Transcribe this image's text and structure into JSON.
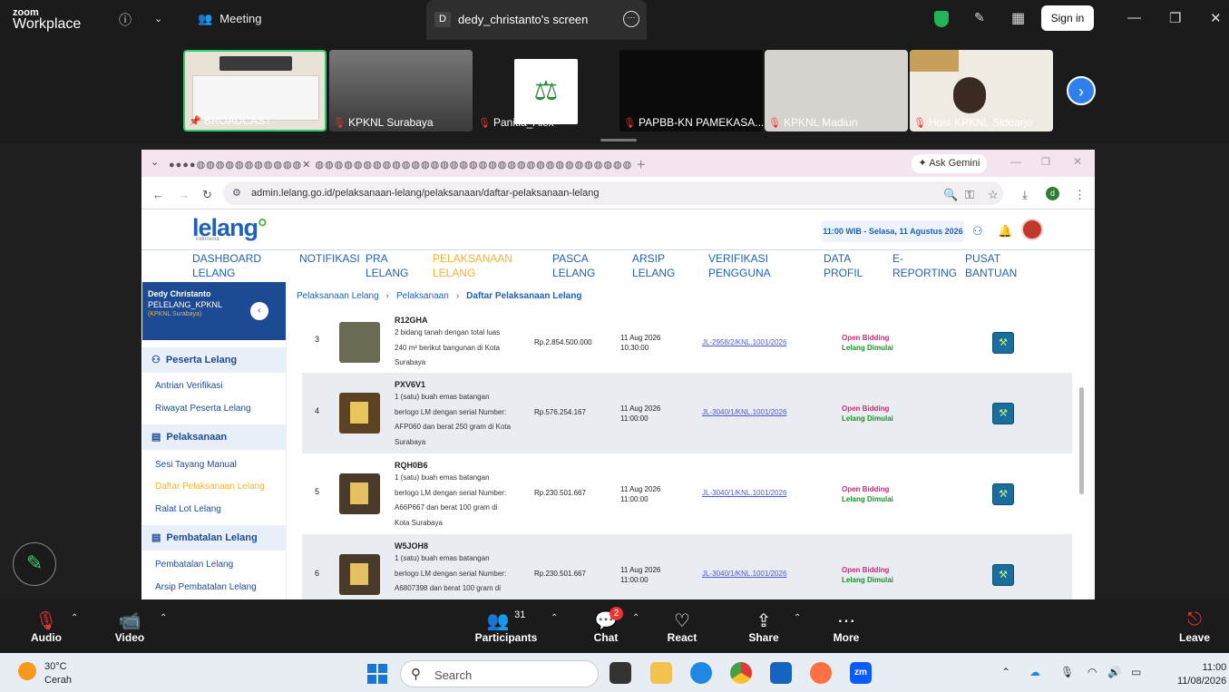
{
  "zoom": {
    "brand_line1": "zoom",
    "brand_line2": "Workplace",
    "meeting_label": "Meeting",
    "screen_tab_initial": "D",
    "screen_tab_title": "dedy_christanto's screen",
    "signin_label": "Sign in",
    "participants": [
      {
        "name": "BROADCAST"
      },
      {
        "name": "KPKNL Surabaya"
      },
      {
        "name": "Panitia_Alex"
      },
      {
        "name": "PAPBB-KN PAMEKASA..."
      },
      {
        "name": "KPKNL Madiun"
      },
      {
        "name": "Host KPKNL Sidoarjo"
      }
    ],
    "toolbar": {
      "audio": "Audio",
      "video": "Video",
      "participants": "Participants",
      "participants_count": "31",
      "chat": "Chat",
      "chat_badge": "2",
      "react": "React",
      "share": "Share",
      "more": "More",
      "leave": "Leave"
    }
  },
  "browser": {
    "gemini_label": "Ask Gemini",
    "url": "admin.lelang.go.id/pelaksanaan-lelang/pelaksanaan/daftar-pelaksanaan-lelang",
    "profile_initial": "d"
  },
  "app": {
    "logo": "lelang",
    "logo_sub": "indonesia",
    "datetime": "11:00 WIB - Selasa, 11 Agustus 2026",
    "nav": [
      {
        "line1": "DASHBOARD",
        "line2": "LELANG"
      },
      {
        "line1": "NOTIFIKASI",
        "line2": ""
      },
      {
        "line1": "PRA",
        "line2": "LELANG"
      },
      {
        "line1": "PELAKSANAAN",
        "line2": "LELANG"
      },
      {
        "line1": "PASCA",
        "line2": "LELANG"
      },
      {
        "line1": "ARSIP",
        "line2": "LELANG"
      },
      {
        "line1": "VERIFIKASI",
        "line2": "PENGGUNA"
      },
      {
        "line1": "DATA",
        "line2": "PROFIL"
      },
      {
        "line1": "E-",
        "line2": "REPORTING"
      },
      {
        "line1": "PUSAT",
        "line2": "BANTUAN"
      }
    ],
    "user": {
      "name": "Dedy Christanto",
      "role": "PELELANG_KPKNL",
      "unit": "(KPKNL Surabaya)"
    },
    "sidebar": {
      "sec_peserta": "Peserta Lelang",
      "antrian": "Antrian Verifikasi",
      "riwayat": "Riwayat Peserta Lelang",
      "sec_pelaksanaan": "Pelaksanaan",
      "sesi": "Sesi Tayang Manual",
      "daftar": "Daftar Pelaksanaan Lelang",
      "ralat": "Ralat Lot Lelang",
      "sec_pembatalan": "Pembatalan Lelang",
      "pembatalan": "Pembatalan Lelang",
      "arsip": "Arsip Pembatalan Lelang"
    },
    "breadcrumb": [
      "Pelaksanaan Lelang",
      "Pelaksanaan",
      "Daftar Pelaksanaan Lelang"
    ],
    "rows": [
      {
        "no": "3",
        "code": "R12GHA",
        "desc": [
          "2 bidang tanah dengan total luas",
          "240 m² berikut bangunan di Kota",
          "Surabaya"
        ],
        "price": "Rp.2.854.500.000",
        "date": "11 Aug 2026",
        "time": "10:30:00",
        "link": "JL-2958/2/KNL.1001/2026",
        "status1": "Open Bidding",
        "status2": "Lelang Dimulai"
      },
      {
        "no": "4",
        "code": "PXV6V1",
        "desc": [
          "1 (satu) buah emas batangan",
          "berlogo LM dengan serial Number:",
          "AFP060 dan berat 250 gram di Kota",
          "Surabaya"
        ],
        "price": "Rp.576.254.167",
        "date": "11 Aug 2026",
        "time": "11:00:00",
        "link": "JL-3040/1/KNL.1001/2026",
        "status1": "Open Bidding",
        "status2": "Lelang Dimulai"
      },
      {
        "no": "5",
        "code": "RQH0B6",
        "desc": [
          "1 (satu) buah emas batangan",
          "berlogo LM dengan serial Number:",
          "A66P667 dan berat 100 gram di",
          "Kota Surabaya"
        ],
        "price": "Rp.230.501.667",
        "date": "11 Aug 2026",
        "time": "11:00:00",
        "link": "JL-3040/1/KNL.1001/2026",
        "status1": "Open Bidding",
        "status2": "Lelang Dimulai"
      },
      {
        "no": "6",
        "code": "W5JOH8",
        "desc": [
          "1 (satu) buah emas batangan",
          "berlogo LM dengan serial Number:",
          "A6807398 dan berat 100 gram di"
        ],
        "price": "Rp.230.501.667",
        "date": "11 Aug 2026",
        "time": "11:00:00",
        "link": "JL-3040/1/KNL.1001/2026",
        "status1": "Open Bidding",
        "status2": "Lelang Dimulai"
      }
    ]
  },
  "taskbar": {
    "temp": "30°C",
    "weather": "Cerah",
    "search": "Search",
    "time": "11:00",
    "date": "11/08/2026"
  }
}
